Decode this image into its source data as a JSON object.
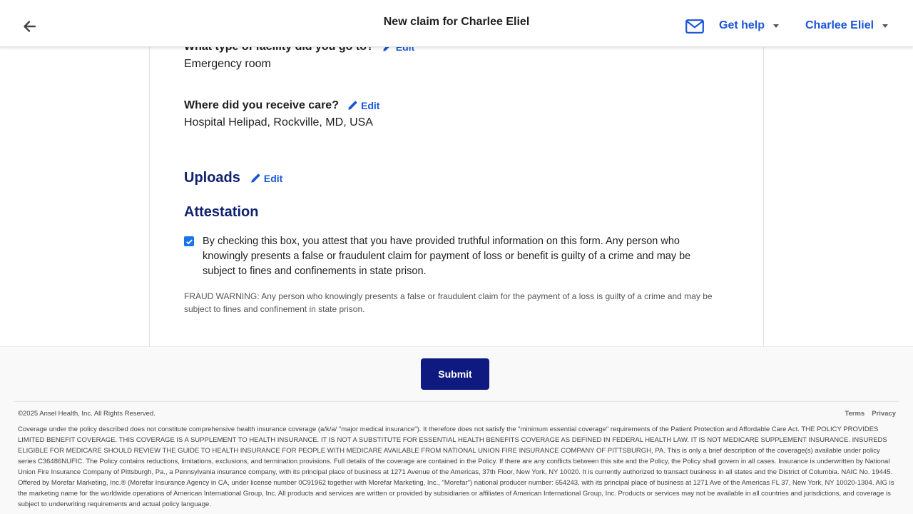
{
  "header": {
    "title": "New claim for Charlee Eliel",
    "help_label": "Get help",
    "user_label": "Charlee Eliel",
    "icons": {
      "back": "arrow-left-icon",
      "mail": "envelope-icon"
    }
  },
  "questions": [
    {
      "label": "What type of facility did you go to?",
      "answer": "Emergency room",
      "edit_label": "Edit"
    },
    {
      "label": "Where did you receive care?",
      "answer": "Hospital Helipad, Rockville, MD, USA",
      "edit_label": "Edit"
    }
  ],
  "uploads": {
    "title": "Uploads",
    "edit_label": "Edit"
  },
  "attestation": {
    "title": "Attestation",
    "checked": true,
    "text": "By checking this box, you attest that you have provided truthful information on this form. Any person who knowingly presents a false or fraudulent claim for payment of loss or benefit is guilty of a crime and may be subject to fines and confinements in state prison.",
    "fraud_warning": "FRAUD WARNING: Any person who knowingly presents a false or fraudulent claim for the payment of a loss is guilty of a crime and may be subject to fines and confinement in state prison."
  },
  "footer": {
    "submit_label": "Submit",
    "copyright": "©2025 Ansel Health, Inc. All Rights Reserved.",
    "links": {
      "terms": "Terms",
      "privacy": "Privacy"
    },
    "legal": "Coverage under the policy described does not constitute comprehensive health insurance coverage (a/k/a/ \"major medical insurance\"). It therefore does not satisfy the \"minimum essential coverage\" requirements of the Patient Protection and Affordable Care Act. THE POLICY PROVIDES LIMITED BENEFIT COVERAGE. THIS COVERAGE IS A SUPPLEMENT TO HEALTH INSURANCE. IT IS NOT A SUBSTITUTE FOR ESSENTIAL HEALTH BENEFITS COVERAGE AS DEFINED IN FEDERAL HEALTH LAW. IT IS NOT MEDICARE SUPPLEMENT INSURANCE. INSUREDS ELIGIBLE FOR MEDICARE SHOULD REVIEW THE GUIDE TO HEALTH INSURANCE FOR PEOPLE WITH MEDICARE AVAILABLE FROM NATIONAL UNION FIRE INSURANCE COMPANY OF PITTSBURGH, PA. This is only a brief description of the coverage(s) available under policy series C36486NUFIC. The Policy contains reductions, limitations, exclusions, and termination provisions. Full details of the coverage are contained in the Policy. If there are any conflicts between this site and the Policy, the Policy shall govern in all cases. Insurance is underwritten by National Union Fire Insurance Company of Pittsburgh, Pa., a Pennsylvania insurance company, with its principal place of business at 1271 Avenue of the Americas, 37th Floor, New York, NY 10020. It is currently authorized to transact business in all states and the District of Columbia. NAIC No. 19445. Offered by Morefar Marketing, Inc.® (Morefar Insurance Agency in CA, under license number 0C91962 together with Morefar Marketing, Inc., \"Morefar\") national producer number: 654243, with its principal place of business at 1271 Ave of the Americas FL 37, New York, NY 10020-1304. AIG is the marketing name for the worldwide operations of American International Group, Inc. All products and services are written or provided by subsidiaries or affiliates of American International Group, Inc. Products or services may not be available in all countries and jurisdictions, and coverage is subject to underwriting requirements and actual policy language."
  },
  "colors": {
    "link_blue": "#1a56d6",
    "section_navy": "#0f2170",
    "submit_navy": "#0f1a80",
    "checkbox_blue": "#1a73e8"
  }
}
